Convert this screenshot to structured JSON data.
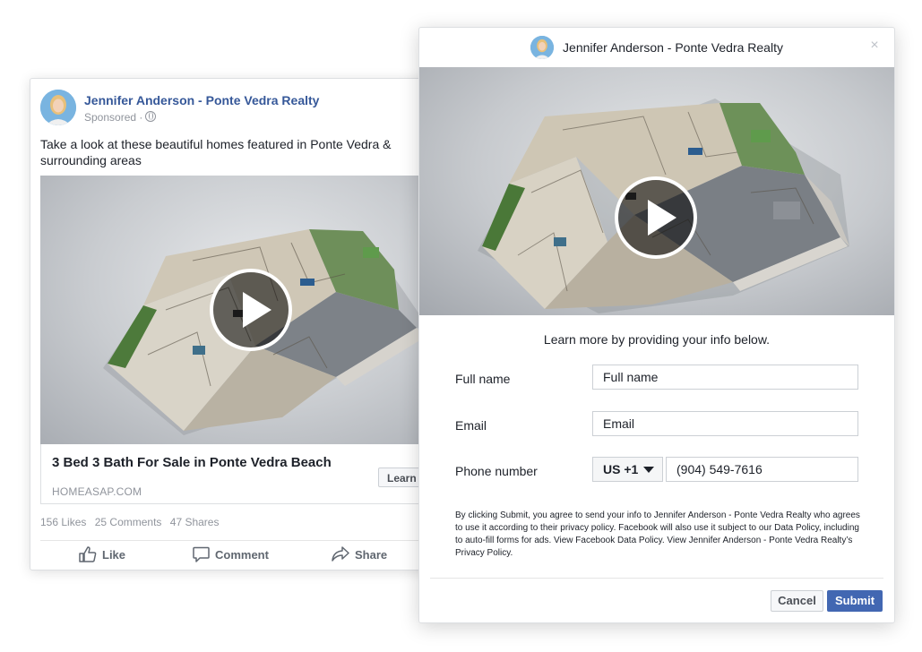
{
  "post": {
    "page_name": "Jennifer Anderson - Ponte Vedra Realty",
    "sponsored": "Sponsored ·",
    "body_text": "Take a look at these beautiful homes featured in Ponte Vedra & surrounding areas",
    "link_title": "3 Bed 3 Bath For Sale in Ponte Vedra Beach",
    "link_domain": "HOMEASAP.COM",
    "cta_label": "Learn",
    "stats": {
      "likes": "156 Likes",
      "comments": "25 Comments",
      "shares": "47 Shares"
    },
    "actions": {
      "like": "Like",
      "comment": "Comment",
      "share": "Share"
    }
  },
  "dialog": {
    "title": "Jennifer Anderson - Ponte Vedra Realty",
    "close_glyph": "×",
    "intro": "Learn more by providing your info below.",
    "fields": {
      "full_name": {
        "label": "Full name",
        "placeholder": "Full name"
      },
      "email": {
        "label": "Email",
        "placeholder": "Email"
      },
      "phone": {
        "label": "Phone number",
        "country_code": "US +1",
        "value": "(904) 549-7616"
      }
    },
    "disclaimer": "By clicking Submit, you agree to send your info to Jennifer Anderson - Ponte Vedra Realty who agrees to use it according to their privacy policy. Facebook will also use it subject to our Data Policy, including to auto-fill forms for ads. View Facebook Data Policy. View Jennifer Anderson - Ponte Vedra Realty’s Privacy Policy.",
    "buttons": {
      "cancel": "Cancel",
      "submit": "Submit"
    }
  },
  "colors": {
    "link_blue": "#365899",
    "submit_blue": "#4267b2",
    "muted_gray": "#90949c"
  },
  "icons": [
    "globe-icon",
    "play-icon",
    "thumbs-up-icon",
    "comment-icon",
    "share-icon",
    "close-icon",
    "chevron-down-icon"
  ]
}
